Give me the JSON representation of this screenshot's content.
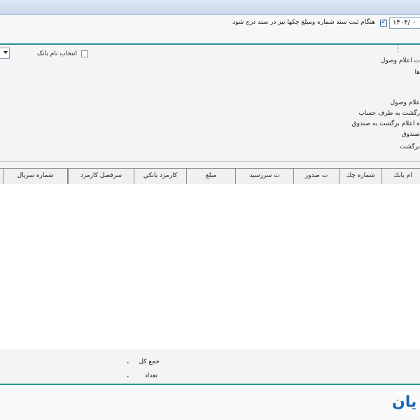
{
  "top": {
    "date_value": "۱۴۰۴/ ۰",
    "register_check_label": "هنگام ثبت سند شماره ومبلغ چکها نیز در سند درج شود"
  },
  "filters": {
    "bank_select_label": "انتخاب نام بانک"
  },
  "left_panel": {
    "items": [
      "ت اعلام وصول",
      "ها",
      "علام وصول",
      "رگشت به طرف حساب",
      "ه اعلام برگشت به صندوق",
      "صندوق",
      "برگشت"
    ]
  },
  "grid": {
    "columns": [
      "ام بانك",
      "شماره چك",
      "ت صدور",
      "ت سررسيد",
      "مبلغ",
      "کارمزد بانکي",
      "سرفصل كارمزد",
      "شماره سريال"
    ]
  },
  "footer": {
    "total_label": "جمع کل",
    "count_label": "تعداد",
    "total_value": ".",
    "count_value": "."
  },
  "branding": {
    "logo_text": "يان",
    "accent_color": "#2b8f99",
    "logo_color": "#1a66b3"
  }
}
